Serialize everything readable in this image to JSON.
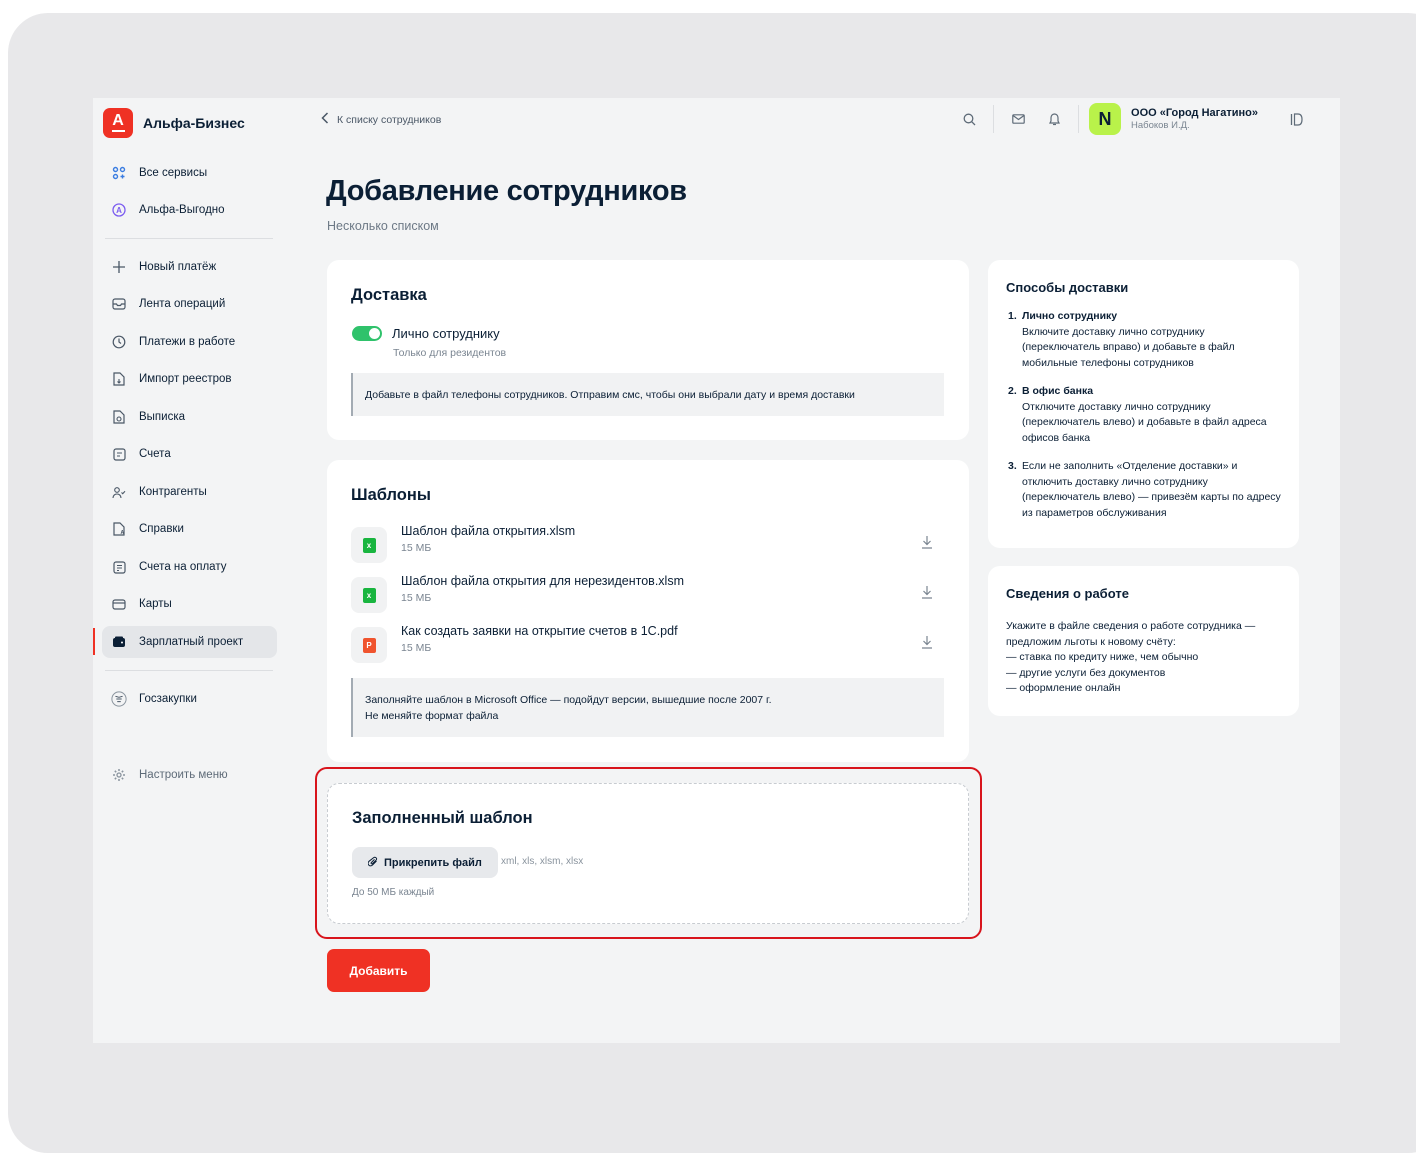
{
  "brand": {
    "name": "Альфа-Бизнес",
    "letter": "А",
    "color": "#ef3124"
  },
  "sidebar": {
    "top_items": [
      {
        "label": "Все сервисы",
        "icon": "grid-icon"
      },
      {
        "label": "Альфа-Выгодно",
        "icon": "alfa-circle-icon"
      }
    ],
    "items": [
      {
        "label": "Новый платёж",
        "icon": "plus-icon"
      },
      {
        "label": "Лента операций",
        "icon": "inbox-icon"
      },
      {
        "label": "Платежи в работе",
        "icon": "clock-icon"
      },
      {
        "label": "Импорт реестров",
        "icon": "document-import-icon"
      },
      {
        "label": "Выписка",
        "icon": "document-search-icon"
      },
      {
        "label": "Счета",
        "icon": "account-icon"
      },
      {
        "label": "Контрагенты",
        "icon": "people-icon"
      },
      {
        "label": "Справки",
        "icon": "document-a-icon"
      },
      {
        "label": "Счета на оплату",
        "icon": "invoice-icon"
      },
      {
        "label": "Карты",
        "icon": "card-icon"
      },
      {
        "label": "Зарплатный проект",
        "icon": "wallet-icon",
        "active": true
      }
    ],
    "extra_item": {
      "label": "Госзакупки",
      "icon": "emblem-icon"
    },
    "settings_item": {
      "label": "Настроить меню",
      "icon": "gear-icon"
    }
  },
  "header": {
    "back_label": "К списку сотрудников",
    "company": {
      "name": "ООО «Город Нагатино»",
      "user": "Набоков И.Д.",
      "logo_letter": "N",
      "logo_color": "#b9f24a"
    }
  },
  "page": {
    "title": "Добавление сотрудников",
    "subtitle": "Несколько списком"
  },
  "delivery": {
    "title": "Доставка",
    "toggle_label": "Лично сотруднику",
    "toggle_on": true,
    "toggle_hint": "Только для резидентов",
    "note": "Добавьте в файл телефоны сотрудников. Отправим смс, чтобы они выбрали дату и время доставки"
  },
  "templates": {
    "title": "Шаблоны",
    "files": [
      {
        "name": "Шаблон файла открытия.xlsm",
        "size": "15 МБ",
        "type": "x"
      },
      {
        "name": "Шаблон файла открытия для нерезидентов.xlsm",
        "size": "15 МБ",
        "type": "x"
      },
      {
        "name": "Как создать заявки на открытие счетов в 1С.pdf",
        "size": "15 МБ",
        "type": "P"
      }
    ],
    "note_line1": "Заполняйте шаблон в Microsoft Office — подойдут версии, вышедшие после 2007 г.",
    "note_line2": "Не меняйте формат файла"
  },
  "upload": {
    "title": "Заполненный шаблон",
    "button": "Прикрепить файл",
    "formats": "xml, xls, xlsm, xlsx",
    "size_hint": "До 50 МБ каждый"
  },
  "submit_label": "Добавить",
  "delivery_methods": {
    "title": "Способы доставки",
    "steps": [
      {
        "num": "1.",
        "title": "Лично сотруднику",
        "text": "Включите доставку лично сотруднику (переключатель вправо) и добавьте в файл мобильные телефоны сотрудников"
      },
      {
        "num": "2.",
        "title": "В офис банка",
        "text": "Отключите доставку лично сотруднику (переключатель влево) и добавьте в файл адреса офисов банка"
      },
      {
        "num": "3.",
        "title": "",
        "text": "Если не заполнить «Отделение доставки» и отключить доставку лично сотруднику (переключатель влево) — привезём карты по адресу из параметров обслуживания"
      }
    ]
  },
  "work_info": {
    "title": "Сведения о работе",
    "lines": [
      "Укажите в файле сведения о работе сотрудника —",
      "предложим льготы к новому счёту:",
      "— ставка по кредиту ниже, чем обычно",
      "— другие услуги без документов",
      "— оформление онлайн"
    ]
  }
}
